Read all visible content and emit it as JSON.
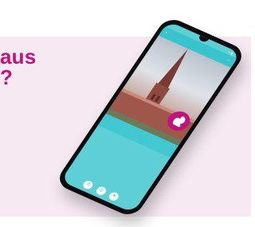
{
  "headline": {
    "line1": "aus",
    "line2": "?"
  },
  "phone": {
    "status_bar": {
      "time": "",
      "icons": "▪▪ ▮"
    },
    "appbar": {
      "back_icon": "‹",
      "title": "",
      "share_icon": "⋯"
    },
    "hero": {
      "caption": ""
    },
    "stats": [
      {
        "label": ""
      },
      {
        "label": ""
      },
      {
        "label": ""
      }
    ],
    "info_lines": [
      "",
      "",
      "",
      ""
    ],
    "nav": [
      {
        "icon": "phone-icon",
        "glyph": "✆"
      },
      {
        "icon": "globe-icon",
        "glyph": "◎"
      },
      {
        "icon": "navigation-icon",
        "glyph": "➤"
      }
    ]
  },
  "colors": {
    "brand": "#c0137e",
    "screen": "#5fcfd6",
    "appbar": "#37c4cc",
    "background": "#f6e9f2"
  }
}
